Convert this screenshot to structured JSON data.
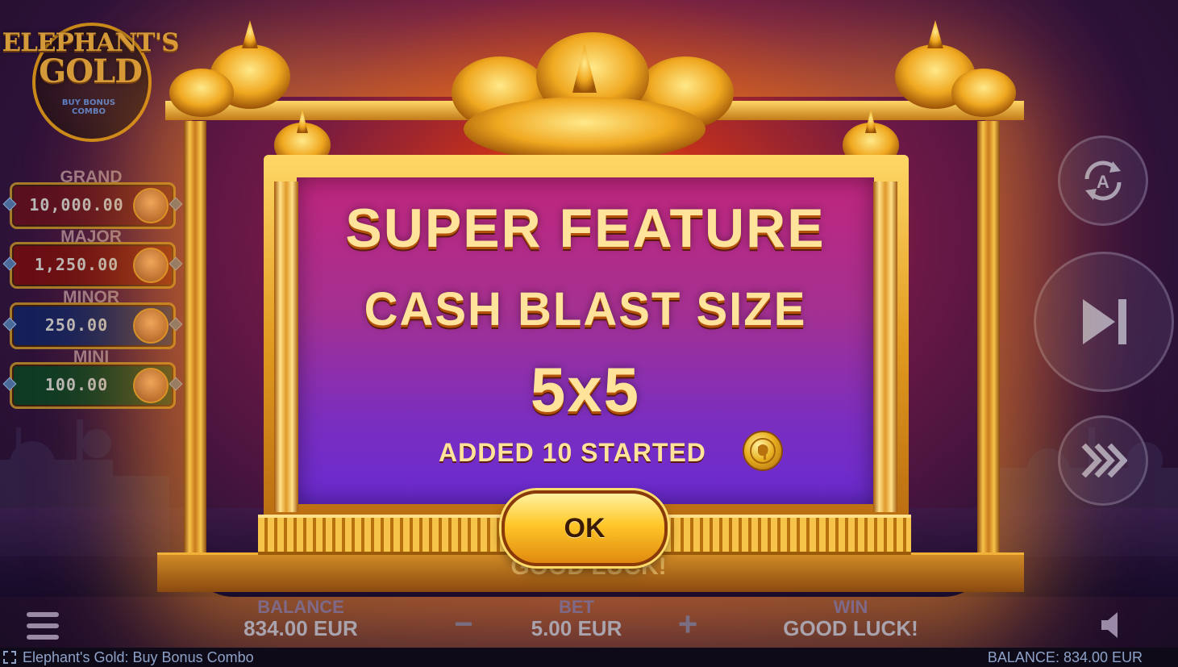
{
  "logo": {
    "title_line1": "ELEPHANT'S",
    "title_line2": "GOLD",
    "sub1": "BUY BONUS",
    "sub2": "COMBO"
  },
  "jackpots": [
    {
      "label": "GRAND",
      "value": "10,000.00",
      "color": "#5a1020"
    },
    {
      "label": "MAJOR",
      "value": "1,250.00",
      "color": "#6a0e14"
    },
    {
      "label": "MINOR",
      "value": "250.00",
      "color": "#14205a"
    },
    {
      "label": "MINI",
      "value": "100.00",
      "color": "#0e3a24"
    }
  ],
  "dialog": {
    "title": "SUPER FEATURE",
    "subtitle": "CASH BLAST SIZE",
    "size": "5x5",
    "message": "ADDED 10 STARTED",
    "ok_label": "OK"
  },
  "reels": {
    "good_luck": "GOOD LUCK!"
  },
  "bottom": {
    "balance_label": "BALANCE",
    "balance_value": "834.00 EUR",
    "bet_label": "BET",
    "bet_value": "5.00 EUR",
    "win_label": "WIN",
    "win_value": "GOOD LUCK!",
    "minus": "−",
    "plus": "+"
  },
  "status_bar": {
    "game_name": "Elephant's Gold: Buy Bonus Combo",
    "balance": "BALANCE: 834.00 EUR"
  },
  "controls": {
    "autoplay_icon": "autoplay-icon",
    "skip_icon": "skip-icon",
    "turbo_icon": "turbo-icon",
    "sound_icon": "sound-icon",
    "menu_icon": "menu-icon",
    "fullscreen_icon": "fullscreen-icon"
  }
}
